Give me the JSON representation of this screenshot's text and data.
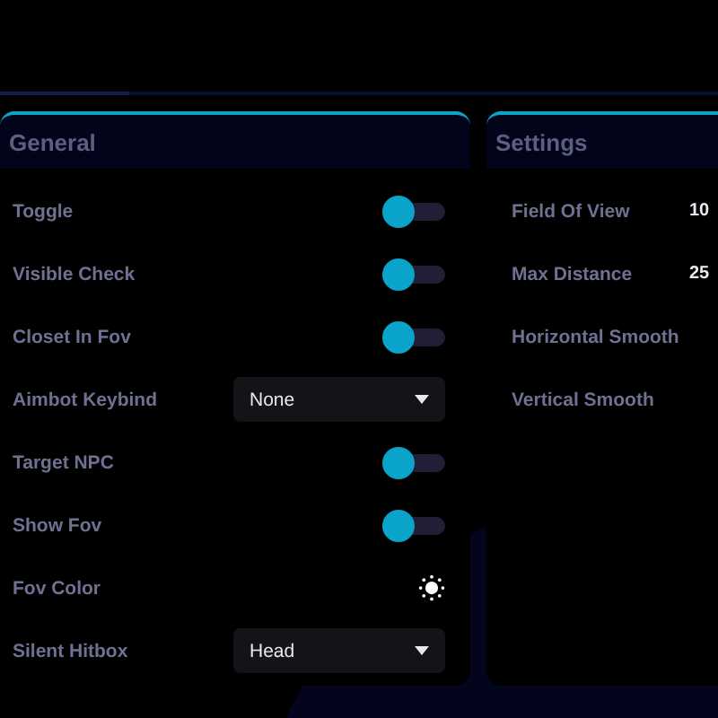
{
  "panels": [
    {
      "title": "General",
      "rows": [
        {
          "kind": "toggle",
          "label": "Toggle",
          "on": true
        },
        {
          "kind": "toggle",
          "label": "Visible Check",
          "on": true
        },
        {
          "kind": "toggle",
          "label": "Closet In Fov",
          "on": true
        },
        {
          "kind": "dropdown",
          "label": "Aimbot Keybind",
          "value": "None"
        },
        {
          "kind": "toggle",
          "label": "Target NPC",
          "on": true
        },
        {
          "kind": "toggle",
          "label": "Show Fov",
          "on": true
        },
        {
          "kind": "color",
          "label": "Fov Color"
        },
        {
          "kind": "dropdown",
          "label": "Silent Hitbox",
          "value": "Head"
        }
      ]
    },
    {
      "title": "Settings",
      "rows": [
        {
          "kind": "value",
          "label": "Field Of View",
          "value": "10"
        },
        {
          "kind": "value",
          "label": "Max Distance",
          "value": "25"
        },
        {
          "kind": "value",
          "label": "Horizontal Smooth"
        },
        {
          "kind": "value",
          "label": "Vertical Smooth"
        }
      ]
    }
  ]
}
